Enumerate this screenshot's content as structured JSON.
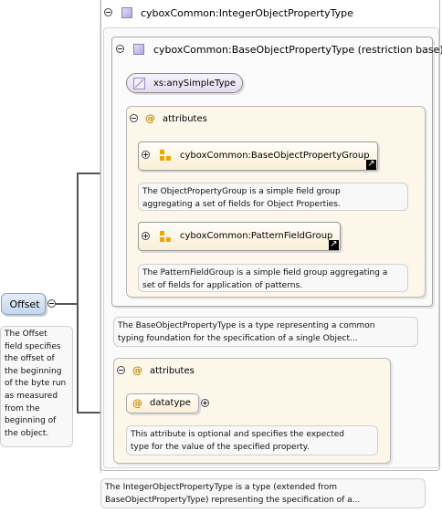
{
  "root": {
    "name": "Offset",
    "doc": [
      "The Offset",
      "field specifies",
      "the offset of",
      "the beginning",
      "of the byte run",
      "as measured",
      "from the",
      "beginning of",
      "the object."
    ]
  },
  "integer_type": {
    "name": "cyboxCommon:IntegerObjectPropertyType",
    "doc": [
      "The IntegerObjectPropertyType is a type (extended from",
      "BaseObjectPropertyType) representing the specification of a..."
    ]
  },
  "base_type": {
    "name": "cyboxCommon:BaseObjectPropertyType (restriction base)",
    "doc": [
      "The BaseObjectPropertyType is a type representing a common",
      "typing foundation for the specification of a single Object..."
    ]
  },
  "simple_type": {
    "name": "xs:anySimpleType"
  },
  "attributes_inner": {
    "label": "attributes"
  },
  "group_1": {
    "name": "cyboxCommon:BaseObjectPropertyGroup",
    "doc": [
      "The ObjectPropertyGroup is a simple field group",
      "aggregating a set of fields for Object Properties."
    ]
  },
  "group_2": {
    "name": "cyboxCommon:PatternFieldGroup",
    "doc": [
      "The PatternFieldGroup is a simple field group aggregating a",
      "set of fields for application of patterns."
    ]
  },
  "attributes_outer": {
    "label": "attributes"
  },
  "datatype": {
    "name": "datatype",
    "doc": [
      "This attribute is optional and specifies the expected",
      "type for the value of the specified property."
    ]
  },
  "icons": {
    "toggle_open": "minus-circle-icon",
    "toggle_closed": "plus-circle-icon",
    "complex_type": "complex-type-icon",
    "simple_type": "simple-type-icon",
    "attribute": "at-sign-icon",
    "group": "attribute-group-icon",
    "link": "link-arrow-icon"
  },
  "colors": {
    "root_fill": "#cfe2f5",
    "group_fill": "#fbefd6",
    "container_fill": "#fdf7ea",
    "note_fill": "#f8f8f8"
  }
}
